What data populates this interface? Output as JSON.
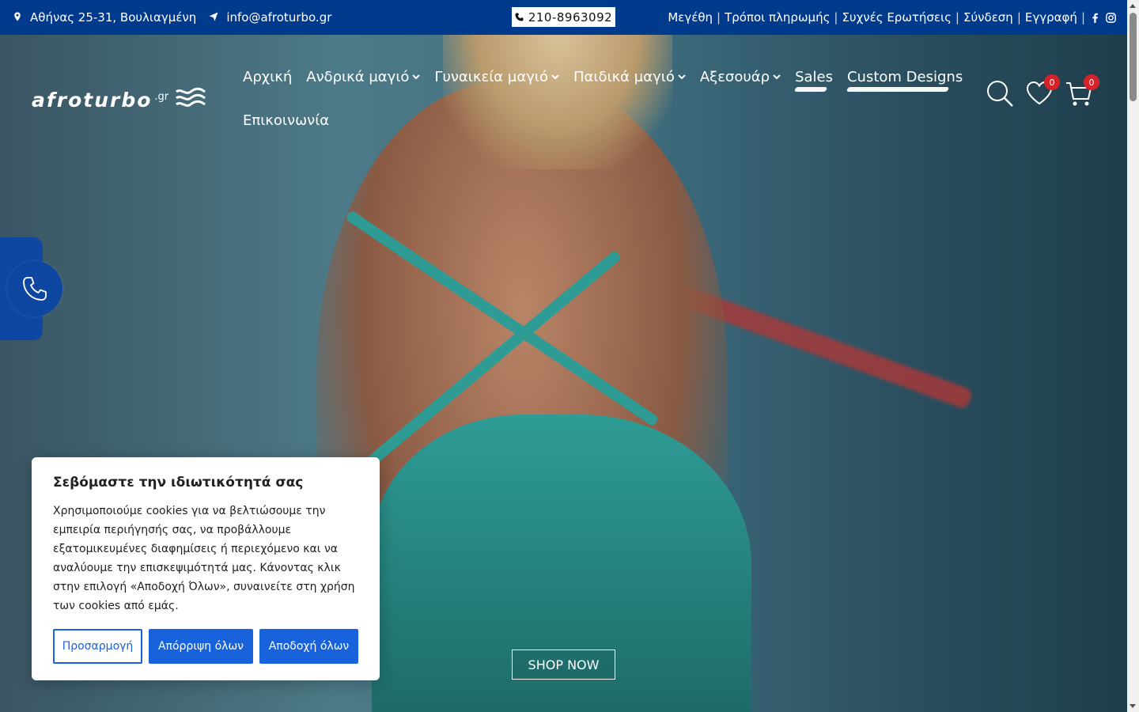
{
  "topbar": {
    "address": "Αθήνας 25-31, Βουλιαγμένη",
    "email": "info@afroturbo.gr",
    "phone": "210-8963092",
    "links": [
      "Μεγέθη",
      "Τρόποι πληρωμής",
      "Συχνές Ερωτήσεις",
      "Σύνδεση",
      "Εγγραφή"
    ],
    "separator": "|",
    "bg_color": "#003a8c"
  },
  "logo": {
    "word": "afroturbo",
    "tld": ".gr"
  },
  "nav": {
    "row1": [
      {
        "label": "Αρχική"
      },
      {
        "label": "Ανδρικά μαγιό"
      },
      {
        "label": "Γυναικεία μαγιό"
      },
      {
        "label": "Παιδικά μαγιό"
      },
      {
        "label": "Αξεσουάρ"
      },
      {
        "label": "Sales"
      },
      {
        "label": "Custom Designs"
      }
    ],
    "row2": [
      {
        "label": "Επικοινωνία"
      }
    ]
  },
  "header_icons": {
    "wishlist_count": "0",
    "cart_count": "0",
    "badge_color": "#d8222a"
  },
  "cookie": {
    "title": "Σεβόμαστε την ιδιωτικότητά σας",
    "text": "Χρησιμοποιούμε cookies για να βελτιώσουμε την εμπειρία περιήγησής σας, να προβάλλουμε εξατομικευμένες διαφημίσεις ή περιεχόμενο και να αναλύουμε την επισκεψιμότητά μας. Κάνοντας κλικ στην επιλογή «Αποδοχή Όλων», συναινείτε στη χρήση των cookies από εμάς.",
    "customize": "Προσαρμογή",
    "reject": "Απόρριψη όλων",
    "accept": "Αποδοχή όλων",
    "accent_color": "#1863dc"
  },
  "hero": {
    "cta": "SHOP NOW"
  }
}
